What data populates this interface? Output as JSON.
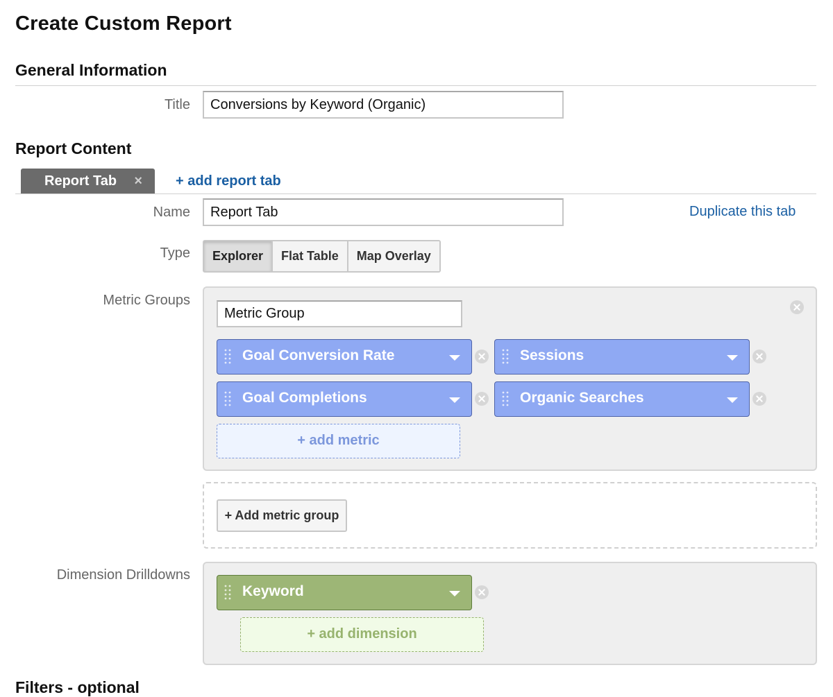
{
  "page": {
    "title": "Create Custom Report"
  },
  "general": {
    "heading": "General Information",
    "title_label": "Title",
    "title_value": "Conversions by Keyword (Organic)"
  },
  "report_content": {
    "heading": "Report Content",
    "tabs": [
      {
        "label": "Report Tab",
        "close_icon": "×"
      }
    ],
    "add_tab_label": "+ add report tab",
    "name_label": "Name",
    "name_value": "Report Tab",
    "duplicate_label": "Duplicate this tab",
    "type_label": "Type",
    "types": [
      {
        "label": "Explorer",
        "selected": true
      },
      {
        "label": "Flat Table",
        "selected": false
      },
      {
        "label": "Map Overlay",
        "selected": false
      }
    ],
    "metric_groups_label": "Metric Groups",
    "metric_group": {
      "name_value": "Metric Group",
      "metrics": [
        {
          "label": "Goal Conversion Rate"
        },
        {
          "label": "Sessions"
        },
        {
          "label": "Goal Completions"
        },
        {
          "label": "Organic Searches"
        }
      ],
      "add_metric_label": "+ add metric"
    },
    "add_metric_group_label": "+ Add metric group",
    "dimension_drilldowns_label": "Dimension Drilldowns",
    "dimensions": [
      {
        "label": "Keyword"
      }
    ],
    "add_dimension_label": "+ add dimension"
  },
  "next_section": {
    "heading": "Filters - optional"
  },
  "colors": {
    "metric_pill": "#8fa9f3",
    "dimension_pill": "#9db676",
    "link": "#1a5fa3",
    "tab_active": "#6b6b6b"
  },
  "icons": {
    "pill_grip": "grip-dots-icon",
    "pill_dropdown": "caret-down-icon",
    "remove": "close-circle-icon"
  }
}
